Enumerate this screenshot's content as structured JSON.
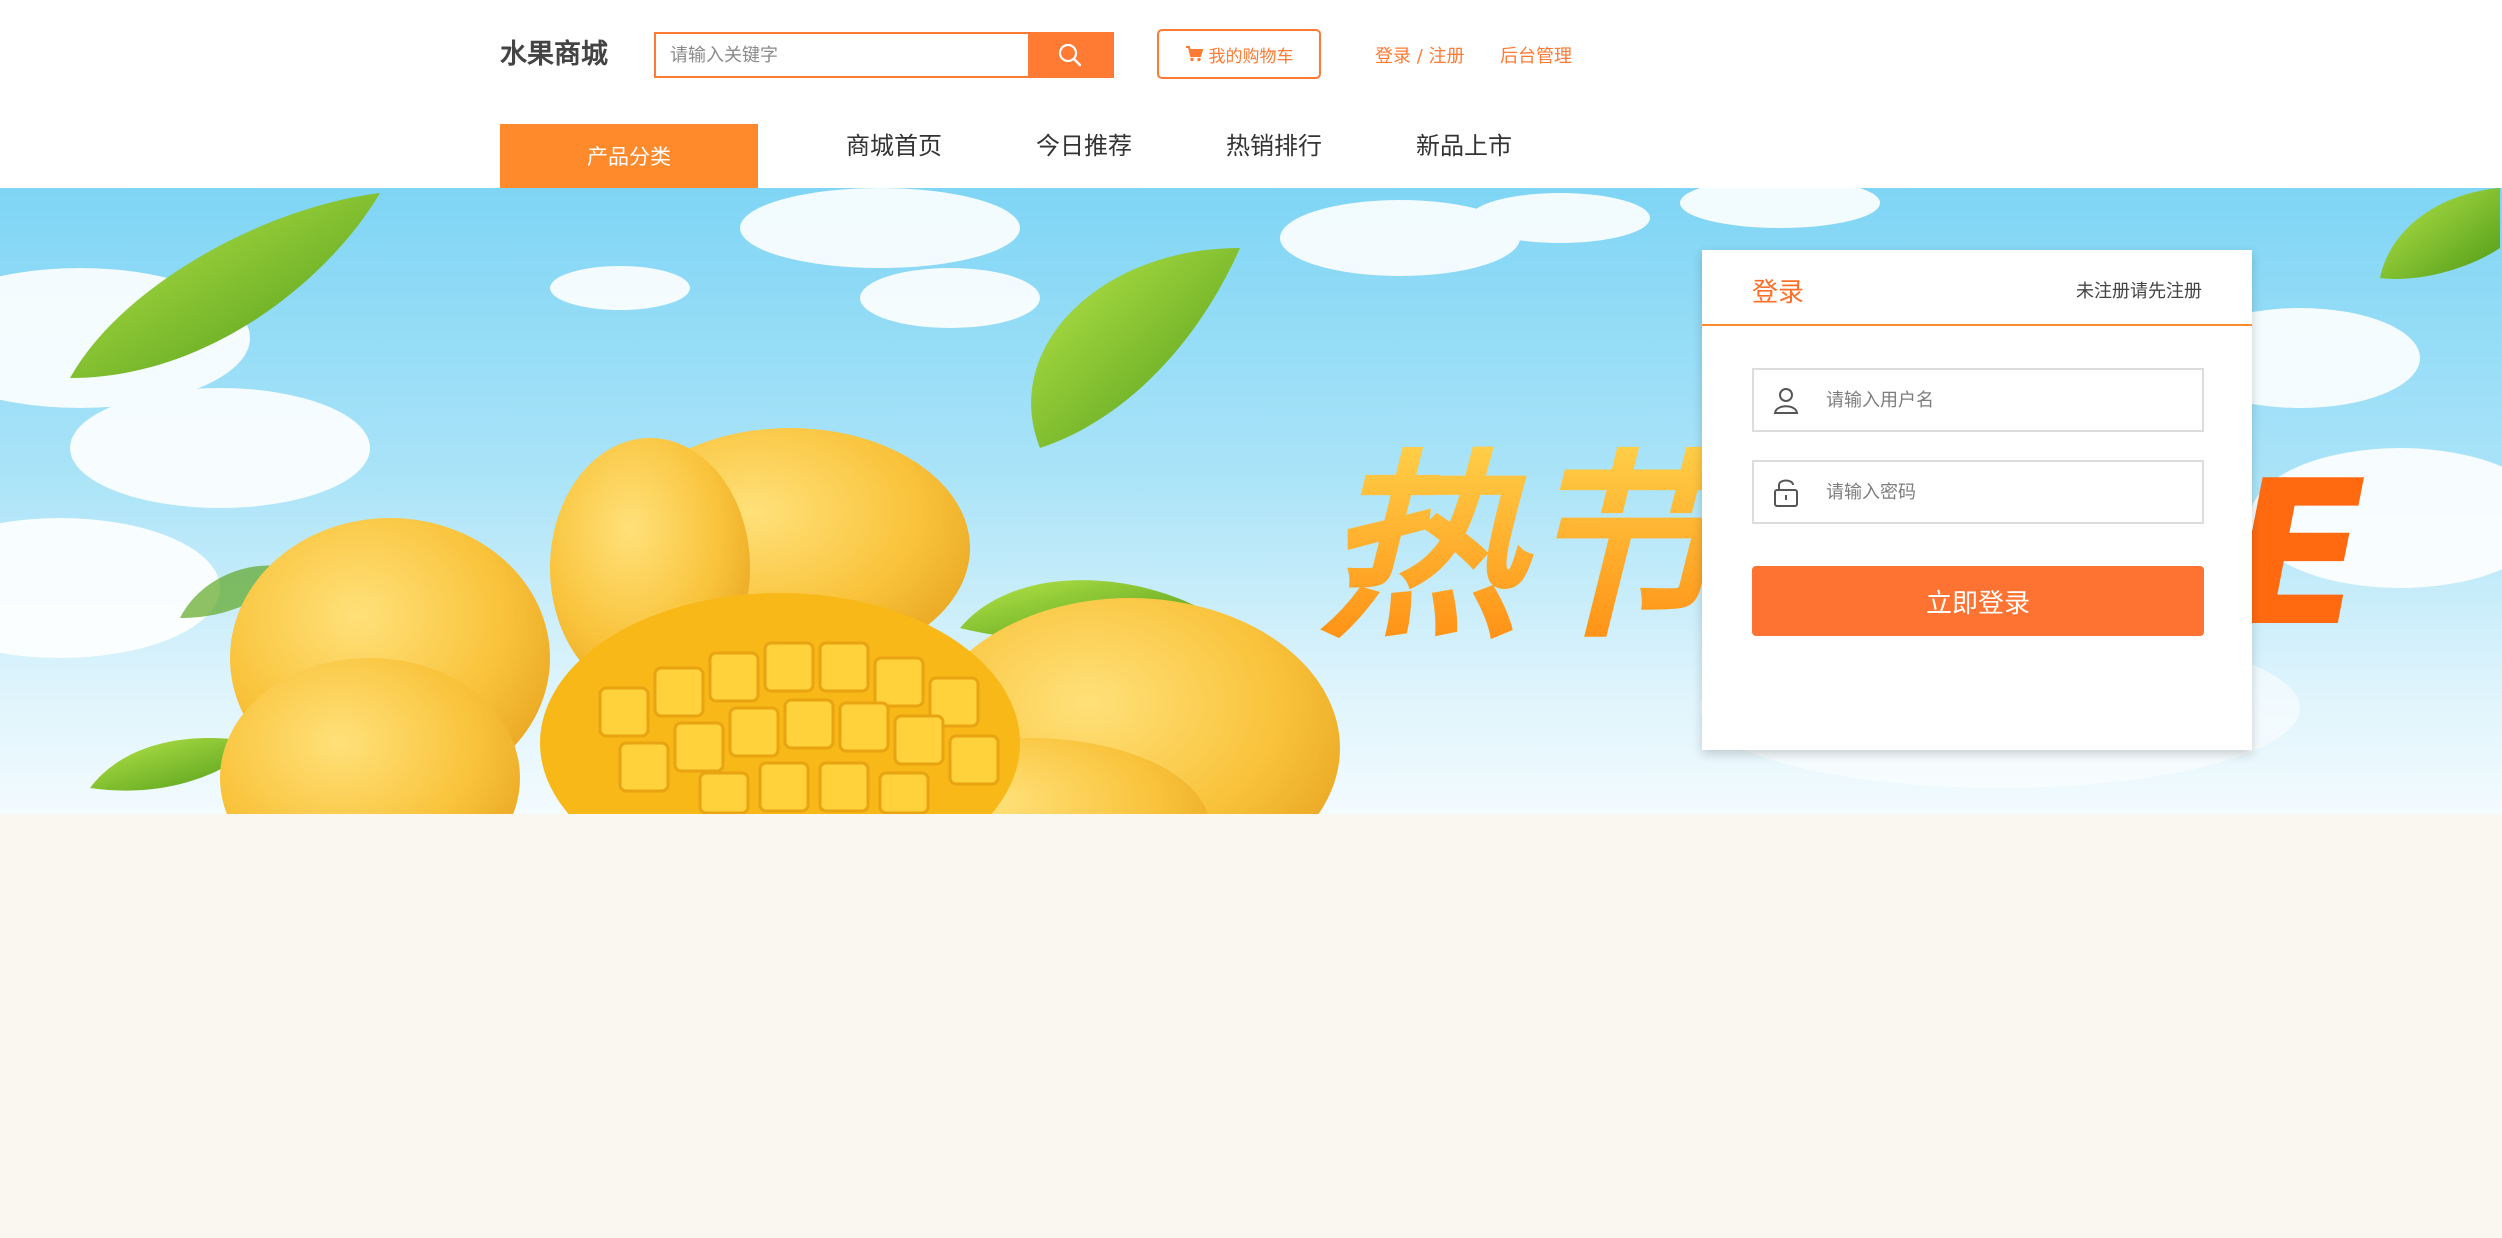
{
  "header": {
    "logo": "水果商城",
    "search": {
      "placeholder": "请输入关键字",
      "value": ""
    },
    "cart_label": "我的购物车",
    "login_register": "登录 / 注册",
    "admin": "后台管理"
  },
  "nav": {
    "category": "产品分类",
    "items": [
      "商城首页",
      "今日推荐",
      "热销排行",
      "新品上市"
    ]
  },
  "banner": {
    "headline": "热节",
    "tail": "E"
  },
  "login": {
    "title": "登录",
    "register_hint": "未注册请先注册",
    "username_placeholder": "请输入用户名",
    "password_placeholder": "请输入密码",
    "submit": "立即登录"
  },
  "colors": {
    "accent": "#ff7a33",
    "nav_category_bg": "#ff8a2c",
    "page_bg": "#faf7f1",
    "sky": "#7fd5f5"
  }
}
